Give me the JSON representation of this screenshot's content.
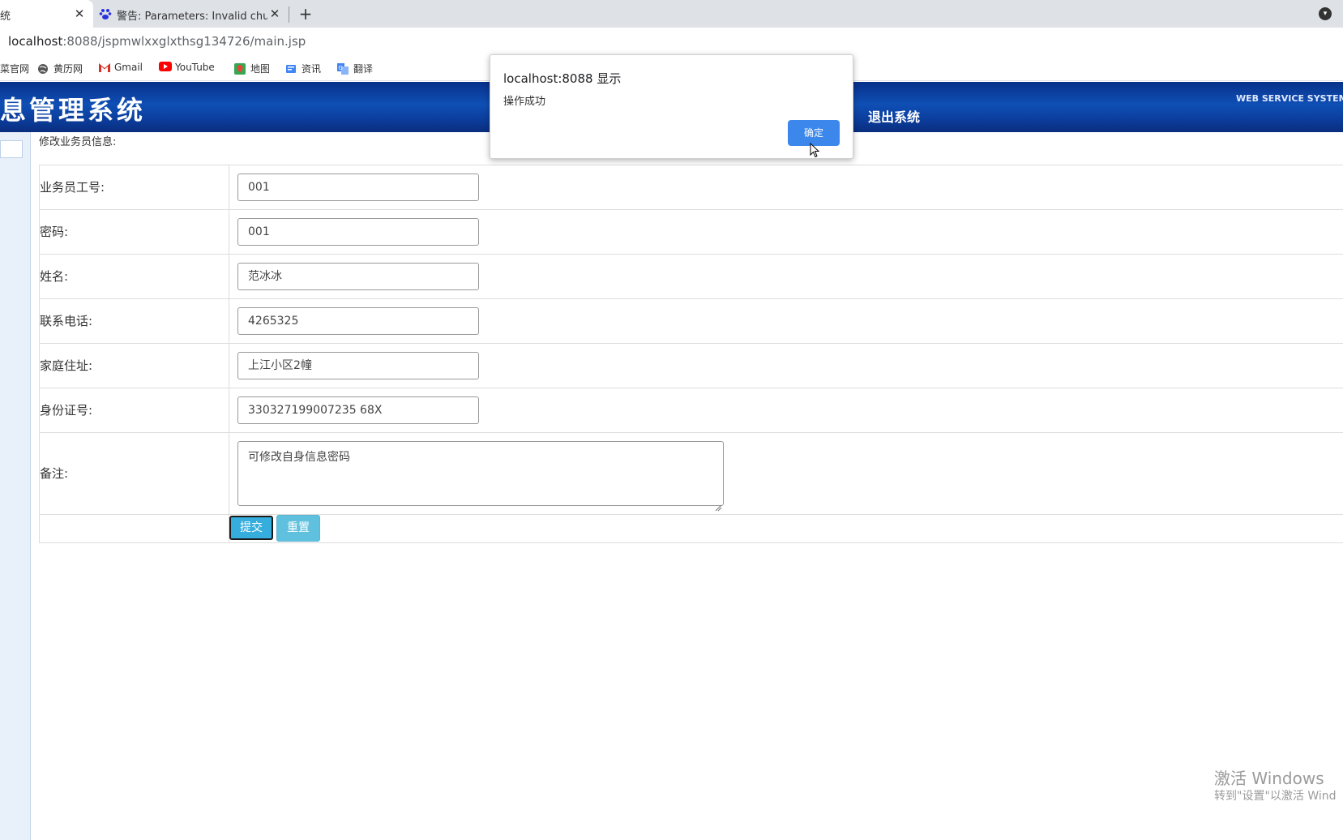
{
  "browser": {
    "tabs": [
      {
        "title": "统",
        "active": true
      },
      {
        "title": "警告: Parameters: Invalid chun",
        "active": false
      }
    ],
    "url_host": "localhost",
    "url_rest": ":8088/jspmwlxxglxthsg134726/main.jsp",
    "bookmarks": [
      {
        "label": "菜官网",
        "icon": "site-icon"
      },
      {
        "label": "黄历网",
        "icon": "globe-icon"
      },
      {
        "label": "Gmail",
        "icon": "gmail-icon"
      },
      {
        "label": "YouTube",
        "icon": "youtube-icon"
      },
      {
        "label": "地图",
        "icon": "maps-icon"
      },
      {
        "label": "资讯",
        "icon": "news-icon"
      },
      {
        "label": "翻译",
        "icon": "translate-icon"
      }
    ]
  },
  "header": {
    "title": "息管理系统",
    "logout": "退出系统",
    "tagline": "WEB SERVICE SYSTEM"
  },
  "form": {
    "section_title": "修改业务员信息:",
    "fields": [
      {
        "label": "业务员工号:",
        "value": "001"
      },
      {
        "label": "密码:",
        "value": "001"
      },
      {
        "label": "姓名:",
        "value": "范冰冰"
      },
      {
        "label": "联系电话:",
        "value": "4265325"
      },
      {
        "label": "家庭住址:",
        "value": "上江小区2幢"
      },
      {
        "label": "身份证号:",
        "value": "330327199007235 68X"
      }
    ],
    "notes": {
      "label": "备注:",
      "value": "可修改自身信息密码"
    },
    "submit": "提交",
    "reset": "重置"
  },
  "dialog": {
    "title": "localhost:8088 显示",
    "message": "操作成功",
    "ok": "确定"
  },
  "watermark": {
    "line1": "激活 Windows",
    "line2": "转到\"设置\"以激活 Wind"
  },
  "colors": {
    "header_blue": "#0f4fb5",
    "submit_bg": "#35aede",
    "reset_bg": "#5fc1de",
    "dialog_button": "#1a73e8"
  }
}
